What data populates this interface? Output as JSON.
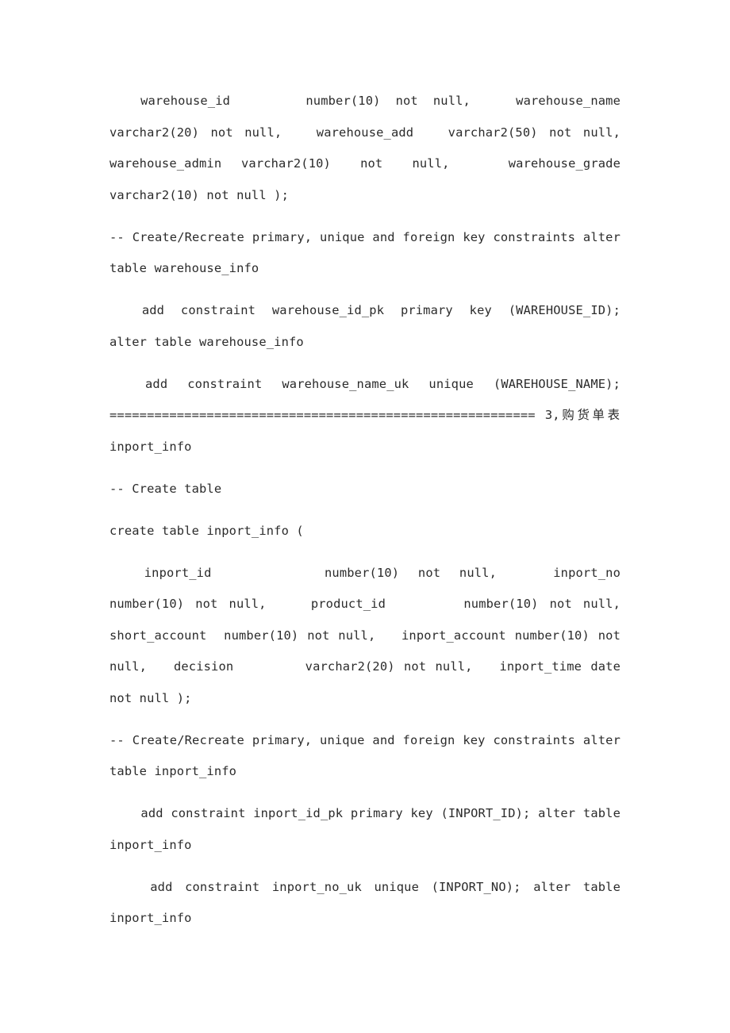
{
  "document": {
    "page_background": "#ffffff",
    "text_color": "#2b2b2b",
    "blocks": [
      {
        "id": "warehouse-columns",
        "indent": true,
        "text": "  warehouse_id          number(10)  not  null,      warehouse_name  varchar2(20) not null,   warehouse_add   varchar2(50) not null, warehouse_admin  varchar2(10)   not   null,      warehouse_grade varchar2(10) not null );"
      },
      {
        "id": "warehouse-constraints-comment",
        "indent": false,
        "text": "-- Create/Recreate primary, unique and foreign key constraints alter table warehouse_info"
      },
      {
        "id": "warehouse-pk",
        "indent": true,
        "text": "  add  constraint  warehouse_id_pk  primary  key  (WAREHOUSE_ID); alter table warehouse_info"
      },
      {
        "id": "warehouse-uk-and-separator",
        "indent": true,
        "separator": true,
        "text_before": "  add  constraint  warehouse_name_uk  unique  (WAREHOUSE_NAME); ",
        "separator_rule": "=========================================================",
        "section_number": " 3,",
        "section_title_cjk": "购货单表",
        "text_after": " inport_info"
      },
      {
        "id": "create-table-comment",
        "indent": false,
        "text": "-- Create table"
      },
      {
        "id": "create-table-stmt",
        "indent": false,
        "text": "create table inport_info ("
      },
      {
        "id": "inport-columns",
        "indent": true,
        "text": "  inport_id            number(10)  not  null,      inport_no number(10) not null,    product_id       number(10) not null, short_account  number(10) not null,   inport_account number(10) not null,   decision        varchar2(20) not null,   inport_time date not null );"
      },
      {
        "id": "inport-constraints-comment",
        "indent": false,
        "text": "-- Create/Recreate primary, unique and foreign key constraints alter table inport_info"
      },
      {
        "id": "inport-pk",
        "indent": true,
        "text": "  add constraint inport_id_pk primary key (INPORT_ID); alter table inport_info"
      },
      {
        "id": "inport-uk",
        "indent": true,
        "text": "  add constraint inport_no_uk unique (INPORT_NO); alter table inport_info"
      }
    ]
  }
}
